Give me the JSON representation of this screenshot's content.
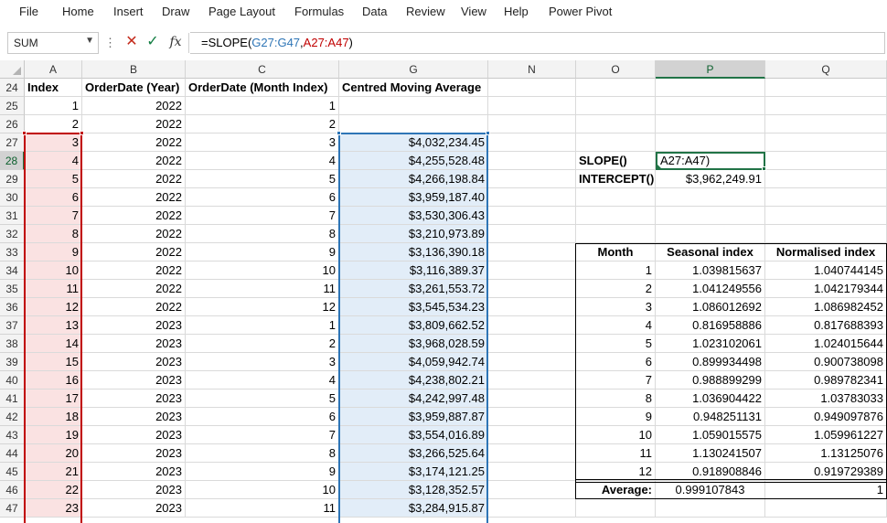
{
  "menu": [
    "File",
    "Home",
    "Insert",
    "Draw",
    "Page Layout",
    "Formulas",
    "Data",
    "Review",
    "View",
    "Help",
    "Power Pivot"
  ],
  "formula_bar": {
    "name_box": "SUM",
    "dots": "⋮",
    "cancel_icon": "✕",
    "enter_icon": "✓",
    "fx_icon": "fx",
    "formula_prefix": "=SLOPE(",
    "formula_ref1": "G27:G47",
    "formula_comma": ",",
    "formula_ref2": "A27:A47",
    "formula_suffix": ")"
  },
  "columns": [
    "A",
    "B",
    "C",
    "G",
    "N",
    "O",
    "P",
    "Q"
  ],
  "active_column": "P",
  "rows": [
    "24",
    "25",
    "26",
    "27",
    "28",
    "29",
    "30",
    "31",
    "32",
    "33",
    "34",
    "35",
    "36",
    "37",
    "38",
    "39",
    "40",
    "41",
    "42",
    "43",
    "44",
    "45",
    "46",
    "47"
  ],
  "active_row": "28",
  "headers": {
    "A": "Index",
    "B": "OrderDate (Year)",
    "C": "OrderDate (Month Index)",
    "G": "Centred Moving Average"
  },
  "data_rows": [
    {
      "A": "1",
      "B": "2022",
      "C": "1",
      "G": ""
    },
    {
      "A": "2",
      "B": "2022",
      "C": "2",
      "G": ""
    },
    {
      "A": "3",
      "B": "2022",
      "C": "3",
      "G": "$4,032,234.45"
    },
    {
      "A": "4",
      "B": "2022",
      "C": "4",
      "G": "$4,255,528.48"
    },
    {
      "A": "5",
      "B": "2022",
      "C": "5",
      "G": "$4,266,198.84"
    },
    {
      "A": "6",
      "B": "2022",
      "C": "6",
      "G": "$3,959,187.40"
    },
    {
      "A": "7",
      "B": "2022",
      "C": "7",
      "G": "$3,530,306.43"
    },
    {
      "A": "8",
      "B": "2022",
      "C": "8",
      "G": "$3,210,973.89"
    },
    {
      "A": "9",
      "B": "2022",
      "C": "9",
      "G": "$3,136,390.18"
    },
    {
      "A": "10",
      "B": "2022",
      "C": "10",
      "G": "$3,116,389.37"
    },
    {
      "A": "11",
      "B": "2022",
      "C": "11",
      "G": "$3,261,553.72"
    },
    {
      "A": "12",
      "B": "2022",
      "C": "12",
      "G": "$3,545,534.23"
    },
    {
      "A": "13",
      "B": "2023",
      "C": "1",
      "G": "$3,809,662.52"
    },
    {
      "A": "14",
      "B": "2023",
      "C": "2",
      "G": "$3,968,028.59"
    },
    {
      "A": "15",
      "B": "2023",
      "C": "3",
      "G": "$4,059,942.74"
    },
    {
      "A": "16",
      "B": "2023",
      "C": "4",
      "G": "$4,238,802.21"
    },
    {
      "A": "17",
      "B": "2023",
      "C": "5",
      "G": "$4,242,997.48"
    },
    {
      "A": "18",
      "B": "2023",
      "C": "6",
      "G": "$3,959,887.87"
    },
    {
      "A": "19",
      "B": "2023",
      "C": "7",
      "G": "$3,554,016.89"
    },
    {
      "A": "20",
      "B": "2023",
      "C": "8",
      "G": "$3,266,525.64"
    },
    {
      "A": "21",
      "B": "2023",
      "C": "9",
      "G": "$3,174,121.25"
    },
    {
      "A": "22",
      "B": "2023",
      "C": "10",
      "G": "$3,128,352.57"
    },
    {
      "A": "23",
      "B": "2023",
      "C": "11",
      "G": "$3,284,915.87"
    }
  ],
  "slope_label": "SLOPE()",
  "slope_edit": "A27:A47)",
  "intercept_label": "INTERCEPT()",
  "intercept_value": "$3,962,249.91",
  "seasonal_table": {
    "headers": [
      "Month",
      "Seasonal index",
      "Normalised index"
    ],
    "rows": [
      [
        "1",
        "1.039815637",
        "1.040744145"
      ],
      [
        "2",
        "1.041249556",
        "1.042179344"
      ],
      [
        "3",
        "1.086012692",
        "1.086982452"
      ],
      [
        "4",
        "0.816958886",
        "0.817688393"
      ],
      [
        "5",
        "1.023102061",
        "1.024015644"
      ],
      [
        "6",
        "0.899934498",
        "0.900738098"
      ],
      [
        "7",
        "0.988899299",
        "0.989782341"
      ],
      [
        "8",
        "1.036904422",
        "1.03783033"
      ],
      [
        "9",
        "0.948251131",
        "0.949097876"
      ],
      [
        "10",
        "1.059015575",
        "1.059961227"
      ],
      [
        "11",
        "1.130241507",
        "1.13125076"
      ],
      [
        "12",
        "0.918908846",
        "0.919729389"
      ]
    ],
    "average_label": "Average:",
    "average_seasonal": "0.999107843",
    "average_normalised": "1"
  },
  "colors": {
    "red_range": "#c00000",
    "blue_range": "#2e75b6",
    "active_green": "#217346"
  }
}
